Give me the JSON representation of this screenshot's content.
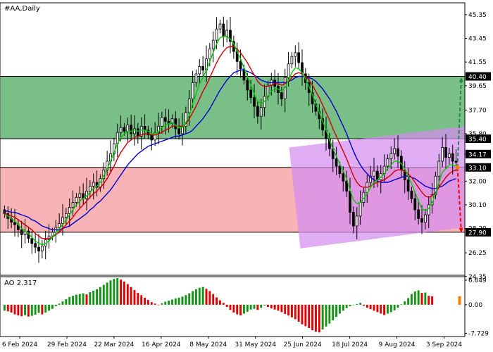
{
  "chart_data": [
    {
      "type": "candlestick",
      "title": "#AA,Daily",
      "ylim": [
        24.45,
        46.3
      ],
      "y_ticks": [
        "45.35",
        "43.45",
        "41.55",
        "39.65",
        "37.70",
        "35.80",
        "34.17",
        "32.00",
        "30.10",
        "28.20",
        "26.25",
        "24.35"
      ],
      "x_ticks": [
        "6 Feb 2024",
        "29 Feb 2024",
        "22 Mar 2024",
        "16 Apr 2024",
        "8 May 2024",
        "31 May 2024",
        "25 Jun 2024",
        "18 Jul 2024",
        "9 Aug 2024",
        "3 Sep 2024"
      ],
      "price_tags": [
        {
          "label": "40.40",
          "value": 40.4,
          "color": "#000000"
        },
        {
          "label": "35.40",
          "value": 35.4,
          "color": "#000000"
        },
        {
          "label": "34.17",
          "value": 34.17,
          "color": "#000000"
        },
        {
          "label": "33.10",
          "value": 33.1,
          "color": "#000000"
        },
        {
          "label": "27.90",
          "value": 27.9,
          "color": "#000000"
        }
      ],
      "zones": [
        {
          "name": "resistance-zone",
          "from": 35.4,
          "to": 40.4,
          "color": "#7bbf88"
        },
        {
          "name": "support-zone",
          "from": 27.9,
          "to": 33.1,
          "color": "#f7b3b6"
        }
      ],
      "channel": {
        "color": "#d48cf0",
        "start": {
          "x": 0.0,
          "low": 26.6,
          "high": 34.7
        },
        "end": {
          "x": 1.0,
          "low": 28.3,
          "high": 36.4
        },
        "start_frac": 0.622
      },
      "closes": [
        29.4,
        29.0,
        28.7,
        28.5,
        28.1,
        27.7,
        28.0,
        27.4,
        27.0,
        26.7,
        26.4,
        26.8,
        27.3,
        27.6,
        27.9,
        28.3,
        28.6,
        29.1,
        29.4,
        29.9,
        30.3,
        30.7,
        31.0,
        30.6,
        31.2,
        31.6,
        31.9,
        31.5,
        32.2,
        32.9,
        33.6,
        34.2,
        35.0,
        35.9,
        36.3,
        36.0,
        36.5,
        35.8,
        36.2,
        35.6,
        36.4,
        36.1,
        35.7,
        35.3,
        35.9,
        36.4,
        37.1,
        36.8,
        36.6,
        37.0,
        36.2,
        35.8,
        36.4,
        37.5,
        38.6,
        39.9,
        40.6,
        41.2,
        40.9,
        41.8,
        42.6,
        43.3,
        44.2,
        44.6,
        43.6,
        44.1,
        43.2,
        42.4,
        41.6,
        41.0,
        40.1,
        39.3,
        38.7,
        38.0,
        37.2,
        37.9,
        38.8,
        39.7,
        40.1,
        39.6,
        39.1,
        38.6,
        40.3,
        41.4,
        42.0,
        42.3,
        41.5,
        40.6,
        39.9,
        39.1,
        38.2,
        37.6,
        37.0,
        36.1,
        35.4,
        34.6,
        33.8,
        33.2,
        32.6,
        32.0,
        31.2,
        29.5,
        28.4,
        29.2,
        30.3,
        31.1,
        31.9,
        32.4,
        32.8,
        32.1,
        32.6,
        33.2,
        33.8,
        34.2,
        34.6,
        34.0,
        32.9,
        32.1,
        31.2,
        30.6,
        29.7,
        29.0,
        28.7,
        29.3,
        30.1,
        30.9,
        32.4,
        33.6,
        34.7,
        33.9,
        34.2,
        33.6,
        33.5
      ],
      "ma_fast": [
        29.3,
        29.2,
        29.0,
        28.8,
        28.5,
        28.2,
        28.0,
        27.8,
        27.5,
        27.2,
        27.0,
        26.9,
        27.0,
        27.2,
        27.5,
        27.8,
        28.2,
        28.5,
        28.9,
        29.3,
        29.7,
        30.1,
        30.4,
        30.6,
        30.8,
        31.1,
        31.4,
        31.6,
        31.9,
        32.4,
        33.0,
        33.6,
        34.3,
        35.0,
        35.5,
        35.8,
        36.0,
        36.0,
        36.1,
        36.0,
        36.1,
        36.1,
        36.0,
        35.8,
        35.8,
        36.0,
        36.3,
        36.5,
        36.6,
        36.7,
        36.5,
        36.3,
        36.3,
        36.7,
        37.3,
        38.2,
        39.0,
        39.8,
        40.3,
        40.9,
        41.6,
        42.3,
        43.0,
        43.5,
        43.6,
        43.6,
        43.4,
        43.0,
        42.4,
        41.8,
        41.1,
        40.4,
        39.7,
        39.0,
        38.4,
        38.2,
        38.4,
        38.8,
        39.2,
        39.4,
        39.4,
        39.2,
        39.5,
        40.1,
        40.7,
        41.1,
        41.0,
        40.7,
        40.2,
        39.6,
        38.9,
        38.2,
        37.5,
        36.8,
        36.1,
        35.3,
        34.6,
        34.0,
        33.4,
        32.8,
        32.2,
        31.3,
        30.5,
        30.2,
        30.3,
        30.6,
        31.0,
        31.5,
        31.9,
        32.1,
        32.3,
        32.6,
        33.0,
        33.3,
        33.6,
        33.6,
        33.4,
        33.0,
        32.4,
        31.8,
        31.1,
        30.4,
        29.8,
        29.6,
        29.8,
        30.3,
        31.0,
        31.9,
        32.7,
        33.0,
        33.3,
        33.3,
        33.2
      ],
      "ma_mid": [
        29.4,
        29.3,
        29.2,
        29.1,
        28.9,
        28.7,
        28.5,
        28.3,
        28.1,
        27.8,
        27.6,
        27.4,
        27.4,
        27.4,
        27.5,
        27.7,
        27.9,
        28.2,
        28.5,
        28.8,
        29.1,
        29.5,
        29.8,
        30.1,
        30.4,
        30.7,
        31.0,
        31.2,
        31.5,
        31.8,
        32.2,
        32.7,
        33.2,
        33.8,
        34.3,
        34.7,
        35.1,
        35.3,
        35.5,
        35.6,
        35.7,
        35.8,
        35.8,
        35.7,
        35.7,
        35.8,
        35.9,
        36.1,
        36.2,
        36.4,
        36.4,
        36.4,
        36.4,
        36.6,
        37.0,
        37.5,
        38.0,
        38.6,
        39.2,
        39.7,
        40.3,
        40.9,
        41.5,
        42.0,
        42.4,
        42.7,
        42.8,
        42.8,
        42.6,
        42.3,
        41.9,
        41.5,
        41.0,
        40.5,
        40.0,
        39.7,
        39.6,
        39.6,
        39.7,
        39.8,
        39.8,
        39.7,
        39.8,
        40.0,
        40.3,
        40.6,
        40.7,
        40.6,
        40.4,
        40.1,
        39.7,
        39.2,
        38.7,
        38.1,
        37.5,
        36.9,
        36.2,
        35.6,
        35.0,
        34.4,
        33.8,
        33.1,
        32.4,
        31.9,
        31.6,
        31.5,
        31.5,
        31.6,
        31.8,
        31.9,
        32.0,
        32.1,
        32.3,
        32.5,
        32.8,
        32.9,
        32.9,
        32.8,
        32.6,
        32.3,
        31.9,
        31.5,
        31.1,
        30.8,
        30.7,
        30.8,
        31.1,
        31.5,
        31.9,
        32.3,
        32.6,
        32.8,
        32.9
      ],
      "ma_slow": [
        29.6,
        29.6,
        29.5,
        29.5,
        29.4,
        29.3,
        29.2,
        29.1,
        28.9,
        28.8,
        28.6,
        28.4,
        28.3,
        28.2,
        28.1,
        28.1,
        28.1,
        28.2,
        28.3,
        28.4,
        28.6,
        28.8,
        29.0,
        29.2,
        29.4,
        29.7,
        29.9,
        30.2,
        30.4,
        30.7,
        31.0,
        31.3,
        31.7,
        32.1,
        32.5,
        32.9,
        33.3,
        33.6,
        33.9,
        34.2,
        34.4,
        34.6,
        34.8,
        34.9,
        35.0,
        35.1,
        35.2,
        35.3,
        35.4,
        35.5,
        35.6,
        35.6,
        35.7,
        35.8,
        35.9,
        36.1,
        36.4,
        36.7,
        37.0,
        37.4,
        37.8,
        38.3,
        38.8,
        39.3,
        39.7,
        40.1,
        40.4,
        40.7,
        40.8,
        40.9,
        40.9,
        40.8,
        40.7,
        40.5,
        40.3,
        40.1,
        40.0,
        39.9,
        39.9,
        39.9,
        39.9,
        39.9,
        39.9,
        40.0,
        40.1,
        40.3,
        40.4,
        40.4,
        40.4,
        40.3,
        40.2,
        40.0,
        39.7,
        39.4,
        39.0,
        38.6,
        38.1,
        37.6,
        37.0,
        36.4,
        35.8,
        35.1,
        34.4,
        33.8,
        33.3,
        32.9,
        32.6,
        32.3,
        32.1,
        32.0,
        31.9,
        31.9,
        31.9,
        32.0,
        32.1,
        32.2,
        32.3,
        32.4,
        32.4,
        32.3,
        32.2,
        32.0,
        31.8,
        31.6,
        31.5,
        31.4,
        31.4,
        31.5,
        31.6,
        31.8,
        32.0,
        32.1,
        32.2
      ],
      "forecast": {
        "origin": 33.1,
        "up_target": 40.3,
        "down_target": 27.9
      }
    },
    {
      "type": "bar",
      "title": "AO 2.317",
      "ylim": [
        -8.6,
        7.6
      ],
      "y_ticks": [
        "6.649",
        "0.00",
        "-7.729"
      ],
      "values": [
        -1.6,
        -1.8,
        -2.1,
        -2.6,
        -2.9,
        -3.1,
        -2.8,
        -3.2,
        -3.0,
        -2.7,
        -2.2,
        -2.6,
        -2.1,
        -1.6,
        -1.1,
        -0.4,
        0.3,
        0.9,
        1.5,
        2.1,
        2.4,
        2.7,
        2.9,
        3.1,
        2.8,
        3.4,
        3.8,
        4.2,
        4.8,
        5.4,
        6.0,
        6.6,
        7.0,
        7.2,
        6.8,
        6.3,
        5.6,
        4.8,
        4.0,
        3.2,
        2.6,
        1.9,
        1.3,
        0.7,
        0.3,
        0.0,
        0.4,
        0.8,
        1.1,
        1.4,
        1.7,
        1.9,
        2.2,
        2.6,
        3.1,
        3.7,
        4.2,
        4.6,
        4.8,
        4.3,
        3.7,
        2.9,
        2.0,
        1.2,
        0.5,
        -0.6,
        -1.4,
        -2.1,
        -2.6,
        -2.9,
        -2.4,
        -1.9,
        -1.3,
        -1.1,
        -1.4,
        -0.8,
        -0.2,
        -0.6,
        -1.0,
        -1.3,
        -1.6,
        -2.0,
        -2.5,
        -2.9,
        -3.4,
        -3.9,
        -4.6,
        -5.3,
        -5.8,
        -6.3,
        -6.9,
        -7.3,
        -7.5,
        -6.7,
        -5.9,
        -5.1,
        -4.2,
        -3.3,
        -2.4,
        -1.6,
        -0.9,
        -0.4,
        -0.1,
        0.2,
        0.5,
        -0.3,
        -0.8,
        -1.2,
        -1.6,
        -2.0,
        -2.4,
        -2.8,
        -2.4,
        -2.0,
        -1.5,
        -0.8,
        0.1,
        0.9,
        1.8,
        2.9,
        3.6,
        3.9,
        3.2,
        3.3,
        2.4,
        2.3
      ]
    }
  ]
}
